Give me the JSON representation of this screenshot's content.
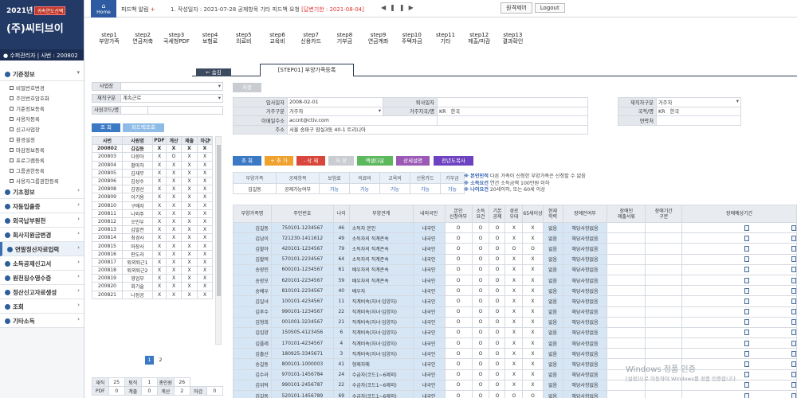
{
  "sidebar": {
    "year": "2021년",
    "year_badge": "귀속연도선택",
    "company": "(주)씨티브이",
    "user": "수퍼관리자 | 사번 : 200802",
    "menu": [
      {
        "label": "기준정보",
        "sub": [
          "비밀번호변경",
          "주민번호암호화",
          "기준정보등록",
          "사용자등록",
          "신고사업장",
          "환경설정",
          "마감정보등록",
          "프로그램등록",
          "그룹권한등록",
          "사용자그룹권한등록"
        ]
      },
      {
        "label": "기초정보"
      },
      {
        "label": "자동입출증"
      },
      {
        "label": "외국납부원천"
      },
      {
        "label": "회사지원금변경"
      },
      {
        "label": "연말정산자료입력"
      },
      {
        "label": "소득공제신고서"
      },
      {
        "label": "원천징수영수증"
      },
      {
        "label": "정산신고자료생성"
      },
      {
        "label": "조회"
      },
      {
        "label": "기타소득"
      }
    ]
  },
  "topbar": {
    "home": "Home",
    "feedback": "피드백 알림",
    "notice_prefix": "1. 작성일자 : 2021-07-28 공제항목 기타 피드백 요청",
    "notice_status": "[답변기한 : 2021-08-04]",
    "remote": "원격제어",
    "logout": "Logout"
  },
  "steps": [
    {
      "top": "step1",
      "bottom": "부양가족"
    },
    {
      "top": "step2",
      "bottom": "연금저축"
    },
    {
      "top": "step3",
      "bottom": "국세청PDF"
    },
    {
      "top": "step4",
      "bottom": "보험료"
    },
    {
      "top": "step5",
      "bottom": "의료비"
    },
    {
      "top": "step6",
      "bottom": "교육비"
    },
    {
      "top": "step7",
      "bottom": "신용카드"
    },
    {
      "top": "step8",
      "bottom": "기부금"
    },
    {
      "top": "step9",
      "bottom": "연금계좌"
    },
    {
      "top": "step10",
      "bottom": "주택자금"
    },
    {
      "top": "step11",
      "bottom": "기타"
    },
    {
      "top": "step12",
      "bottom": "제출/마감"
    },
    {
      "top": "step13",
      "bottom": "결과확인"
    }
  ],
  "tabs": {
    "prev": "← 숨김",
    "current": "[STEP01] 부양가족등록"
  },
  "filters": {
    "site_label": "사업장",
    "site_value": "",
    "status_label": "재직구분",
    "status_value": "계속근로",
    "code_label": "사원코드/명",
    "code_value": "",
    "search": "조 회",
    "feedback_search": "피드백조회"
  },
  "emp_table": {
    "headers": [
      "사번",
      "사원명",
      "PDF",
      "계산",
      "제출",
      "마감"
    ],
    "rows": [
      [
        "200802",
        "김길동",
        "X",
        "X",
        "X",
        "X"
      ],
      [
        "200803",
        "다향아",
        "X",
        "O",
        "X",
        "X"
      ],
      [
        "200804",
        "황마하",
        "X",
        "X",
        "X",
        "X"
      ],
      [
        "200805",
        "김재무",
        "X",
        "X",
        "X",
        "X"
      ],
      [
        "200806",
        "김성수",
        "X",
        "X",
        "X",
        "X"
      ],
      [
        "200808",
        "김영선",
        "X",
        "X",
        "X",
        "X"
      ],
      [
        "200809",
        "이기용",
        "X",
        "X",
        "X",
        "X"
      ],
      [
        "200810",
        "구매자",
        "X",
        "X",
        "X",
        "X"
      ],
      [
        "200811",
        "나외주",
        "X",
        "X",
        "X",
        "X"
      ],
      [
        "200812",
        "오민우",
        "X",
        "X",
        "X",
        "X"
      ],
      [
        "200813",
        "김발전",
        "X",
        "X",
        "X",
        "X"
      ],
      [
        "200814",
        "최경사",
        "X",
        "X",
        "X",
        "X"
      ],
      [
        "200815",
        "마장사",
        "X",
        "X",
        "X",
        "X"
      ],
      [
        "200816",
        "판도라",
        "X",
        "X",
        "X",
        "X"
      ],
      [
        "200817",
        "퇴외퇴근1",
        "X",
        "X",
        "X",
        "X"
      ],
      [
        "200818",
        "퇴외퇴근2",
        "X",
        "X",
        "X",
        "X"
      ],
      [
        "200819",
        "영업부",
        "X",
        "X",
        "X",
        "X"
      ],
      [
        "200820",
        "회기술",
        "X",
        "X",
        "X",
        "X"
      ],
      [
        "200821",
        "나정공",
        "X",
        "X",
        "X",
        "X"
      ]
    ]
  },
  "pager": [
    "1",
    "2"
  ],
  "totals": [
    [
      "재직",
      "25",
      "퇴직",
      "1",
      "총인원",
      "26"
    ],
    [
      "PDF",
      "0",
      "계출",
      "0",
      "계산",
      "2",
      "마감",
      "0"
    ]
  ],
  "info": {
    "gray_btn": "저장",
    "join_label": "입사일자",
    "join_value": "2008-02-01",
    "retire_label": "퇴사일자",
    "retire_value": "",
    "worktype_label": "재직자구분",
    "worktype_value": "거주자",
    "resid_label": "거주구분",
    "resid_value": "거주자",
    "country_label": "거주지국/명",
    "country_code": "KR",
    "country_name": "한국",
    "nation_label": "국적/명",
    "nation_code": "KR",
    "nation_name": "한국",
    "email_label": "이메일주소",
    "email_value": "accnt@ctiv.com",
    "phone_label": "연락처",
    "phone_value": "",
    "addr_label": "주소",
    "addr_value": "서울 송파구 잠실3동 40-1 트리니아"
  },
  "action_buttons": [
    "조 회",
    "+ 추 가",
    "- 삭 제",
    "저 장",
    "엑셀다운",
    "상세설명",
    "전년도복사"
  ],
  "summary": {
    "headers": [
      "부양가족",
      "공제항목",
      "보험료",
      "의료비",
      "교육비",
      "신용카드",
      "기부금"
    ],
    "row": [
      "김길동",
      "공제가능여부",
      "가능",
      "가능",
      "가능",
      "가능",
      "가능"
    ]
  },
  "notes": [
    {
      "b": "※ 본인인적",
      "t": " 다른 가족이 신청한 부양가족은 신청할 수 없음"
    },
    {
      "b": "※ 소득요건",
      "t": " 연간 소득금액 100만원 이하"
    },
    {
      "b": "※ 나이요건",
      "t": " 20세이하, 또는 60세 이상"
    }
  ],
  "dep_table": {
    "headers": [
      "부양가족명",
      "주민번호",
      "나이",
      "부양관계",
      "내외국인",
      "본인\n신청여부",
      "소득\n요건",
      "기본\n공제",
      "경로\n우대",
      "65세이상",
      "현재\n학력",
      "장애인여부",
      "장애인\n제출서류",
      "장애기간\n구분",
      "장애예상기간"
    ],
    "rows": [
      [
        "김길동",
        "750101-1234567",
        "46",
        "소득자 본인",
        "내국인",
        "O",
        "O",
        "O",
        "X",
        "X",
        "없음",
        "해당사항없음"
      ],
      [
        "김남이",
        "721230-1411612",
        "49",
        "소득자의 직계존속",
        "내국인",
        "O",
        "O",
        "O",
        "X",
        "X",
        "없음",
        "해당사항없음"
      ],
      [
        "김할아",
        "420101-1234567",
        "79",
        "소득자의 직계존속",
        "내국인",
        "O",
        "O",
        "O",
        "O",
        "O",
        "없음",
        "해당사항없음"
      ],
      [
        "김할머",
        "570101-2234567",
        "64",
        "소득자의 직계존속",
        "내국인",
        "O",
        "O",
        "O",
        "X",
        "X",
        "없음",
        "해당사항없음"
      ],
      [
        "송장인",
        "600101-1234567",
        "61",
        "배우자의 직계존속",
        "내국인",
        "O",
        "O",
        "O",
        "X",
        "X",
        "없음",
        "해당사항없음"
      ],
      [
        "송장모",
        "620101-2234567",
        "59",
        "배우자의 직계존속",
        "내국인",
        "O",
        "O",
        "O",
        "X",
        "X",
        "없음",
        "해당사항없음"
      ],
      [
        "송배우",
        "810101-2234567",
        "40",
        "배우자",
        "내국인",
        "O",
        "O",
        "O",
        "X",
        "X",
        "없음",
        "해당사항없음"
      ],
      [
        "김일녀",
        "100101-4234567",
        "11",
        "직계비속(자녀·입양자)",
        "내국인",
        "O",
        "O",
        "O",
        "X",
        "X",
        "없음",
        "해당사항없음"
      ],
      [
        "김후수",
        "990101-1234567",
        "22",
        "직계비속(자녀·입양자)",
        "내국인",
        "O",
        "O",
        "O",
        "X",
        "X",
        "없음",
        "해당사항없음"
      ],
      [
        "김형희",
        "001001-3234567",
        "21",
        "직계비속(자녀·입양자)",
        "내국인",
        "O",
        "O",
        "O",
        "X",
        "X",
        "없음",
        "해당사항없음"
      ],
      [
        "김입양",
        "150505-4123456",
        "6",
        "직계비속(자녀·입양자)",
        "내국인",
        "O",
        "O",
        "O",
        "X",
        "X",
        "없음",
        "해당사항없음"
      ],
      [
        "김플레",
        "170101-4234567",
        "4",
        "직계비속(자녀·입양자)",
        "내국인",
        "O",
        "O",
        "O",
        "X",
        "X",
        "없음",
        "해당사항없음"
      ],
      [
        "김출산",
        "180925-3345671",
        "3",
        "직계비속(자녀·입양자)",
        "내국인",
        "O",
        "O",
        "O",
        "X",
        "X",
        "없음",
        "해당사항없음"
      ],
      [
        "송길동",
        "800101-1000003",
        "41",
        "형제자매",
        "내국인",
        "O",
        "O",
        "O",
        "X",
        "X",
        "없음",
        "해당사항없음"
      ],
      [
        "김수라",
        "970101-1456784",
        "24",
        "수급자(코드1~6제외)",
        "내국인",
        "O",
        "O",
        "O",
        "X",
        "X",
        "없음",
        "해당사항없음"
      ],
      [
        "김위탁",
        "990101-2456787",
        "22",
        "수급자(코드1~6제외)",
        "내국인",
        "O",
        "O",
        "O",
        "X",
        "X",
        "없음",
        "해당사항없음"
      ],
      [
        "김길동",
        "520101-1456789",
        "69",
        "수급자(코드1~6제외)",
        "내국인",
        "O",
        "O",
        "O",
        "O",
        "O",
        "없음",
        "해당사항없음"
      ]
    ]
  },
  "watermark": {
    "line1": "Windows 정품 인증",
    "line2": "[설정]으로 이동하여 Windows를 정품 인증합니다."
  }
}
